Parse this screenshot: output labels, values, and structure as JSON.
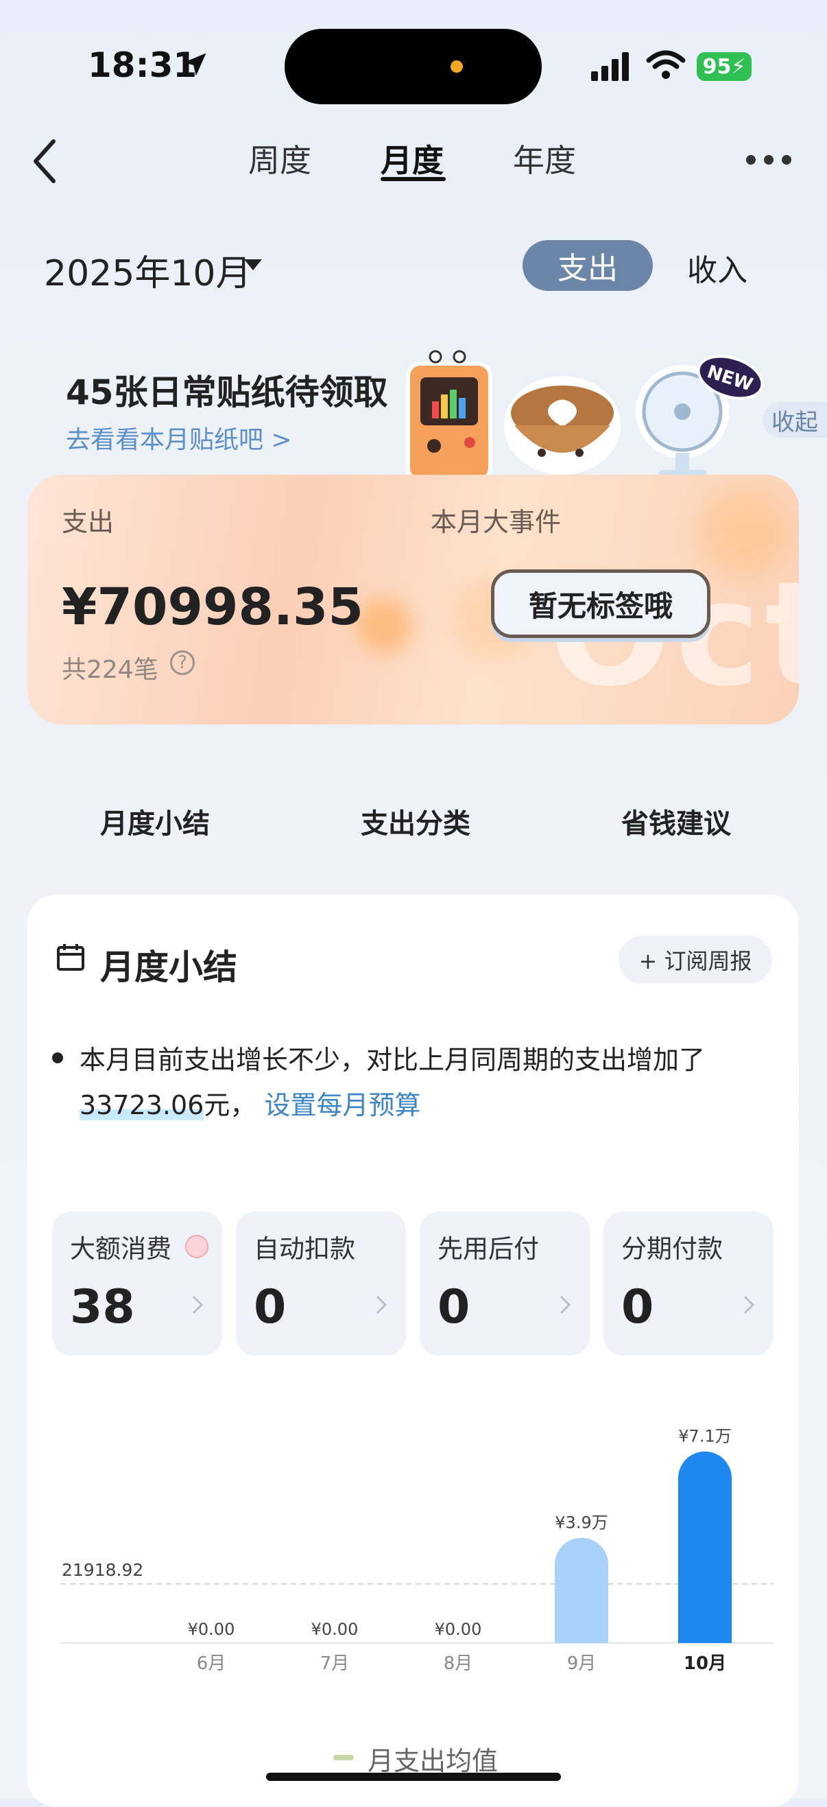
{
  "status_bar": {
    "time": "18:31",
    "battery": "95"
  },
  "nav": {
    "tabs": [
      "周度",
      "月度",
      "年度"
    ],
    "active_tab": "月度"
  },
  "month_selector": {
    "label": "2025年10月"
  },
  "segment": {
    "expense": "支出",
    "income": "收入",
    "active": "支出"
  },
  "sticker_banner": {
    "title": "45张日常贴纸待领取",
    "link": "去看看本月贴纸吧 >",
    "badge": "NEW",
    "collapse": "收起"
  },
  "summary_card": {
    "expense_label": "支出",
    "events_label": "本月大事件",
    "amount": "¥70998.35",
    "count": "共224笔",
    "tag": "暂无标签哦",
    "watermark": "Oct"
  },
  "section_tabs": [
    "月度小结",
    "支出分类",
    "省钱建议"
  ],
  "monthly_summary": {
    "title": "月度小结",
    "subscribe": "+ 订阅周报",
    "text_before": "本月目前支出增长不少，对比上月同周期的支出增加了",
    "highlight_amount": "33723.06",
    "text_after": "元，",
    "budget_link": "设置每月预算"
  },
  "stat_tiles": [
    {
      "label": "大额消费",
      "value": "38"
    },
    {
      "label": "自动扣款",
      "value": "0"
    },
    {
      "label": "先用后付",
      "value": "0"
    },
    {
      "label": "分期付款",
      "value": "0"
    }
  ],
  "chart_data": {
    "type": "bar",
    "categories": [
      "6月",
      "7月",
      "8月",
      "9月",
      "10月"
    ],
    "values": [
      0,
      0,
      0,
      39000,
      71000
    ],
    "data_labels": [
      "¥0.00",
      "¥0.00",
      "¥0.00",
      "¥3.9万",
      "¥7.1万"
    ],
    "average_value": 21918.92,
    "average_label": "21918.92",
    "legend": "月支出均值",
    "ylim": [
      0,
      75000
    ],
    "highlight_category": "10月",
    "colors": {
      "bar_normal": "#a9d2fb",
      "bar_highlight": "#1f87f0",
      "avg_line": "#cfd6df"
    }
  },
  "colors": {
    "accent": "#6b86a8",
    "link": "#3d86c6",
    "card_orange": "#fccfb6"
  }
}
